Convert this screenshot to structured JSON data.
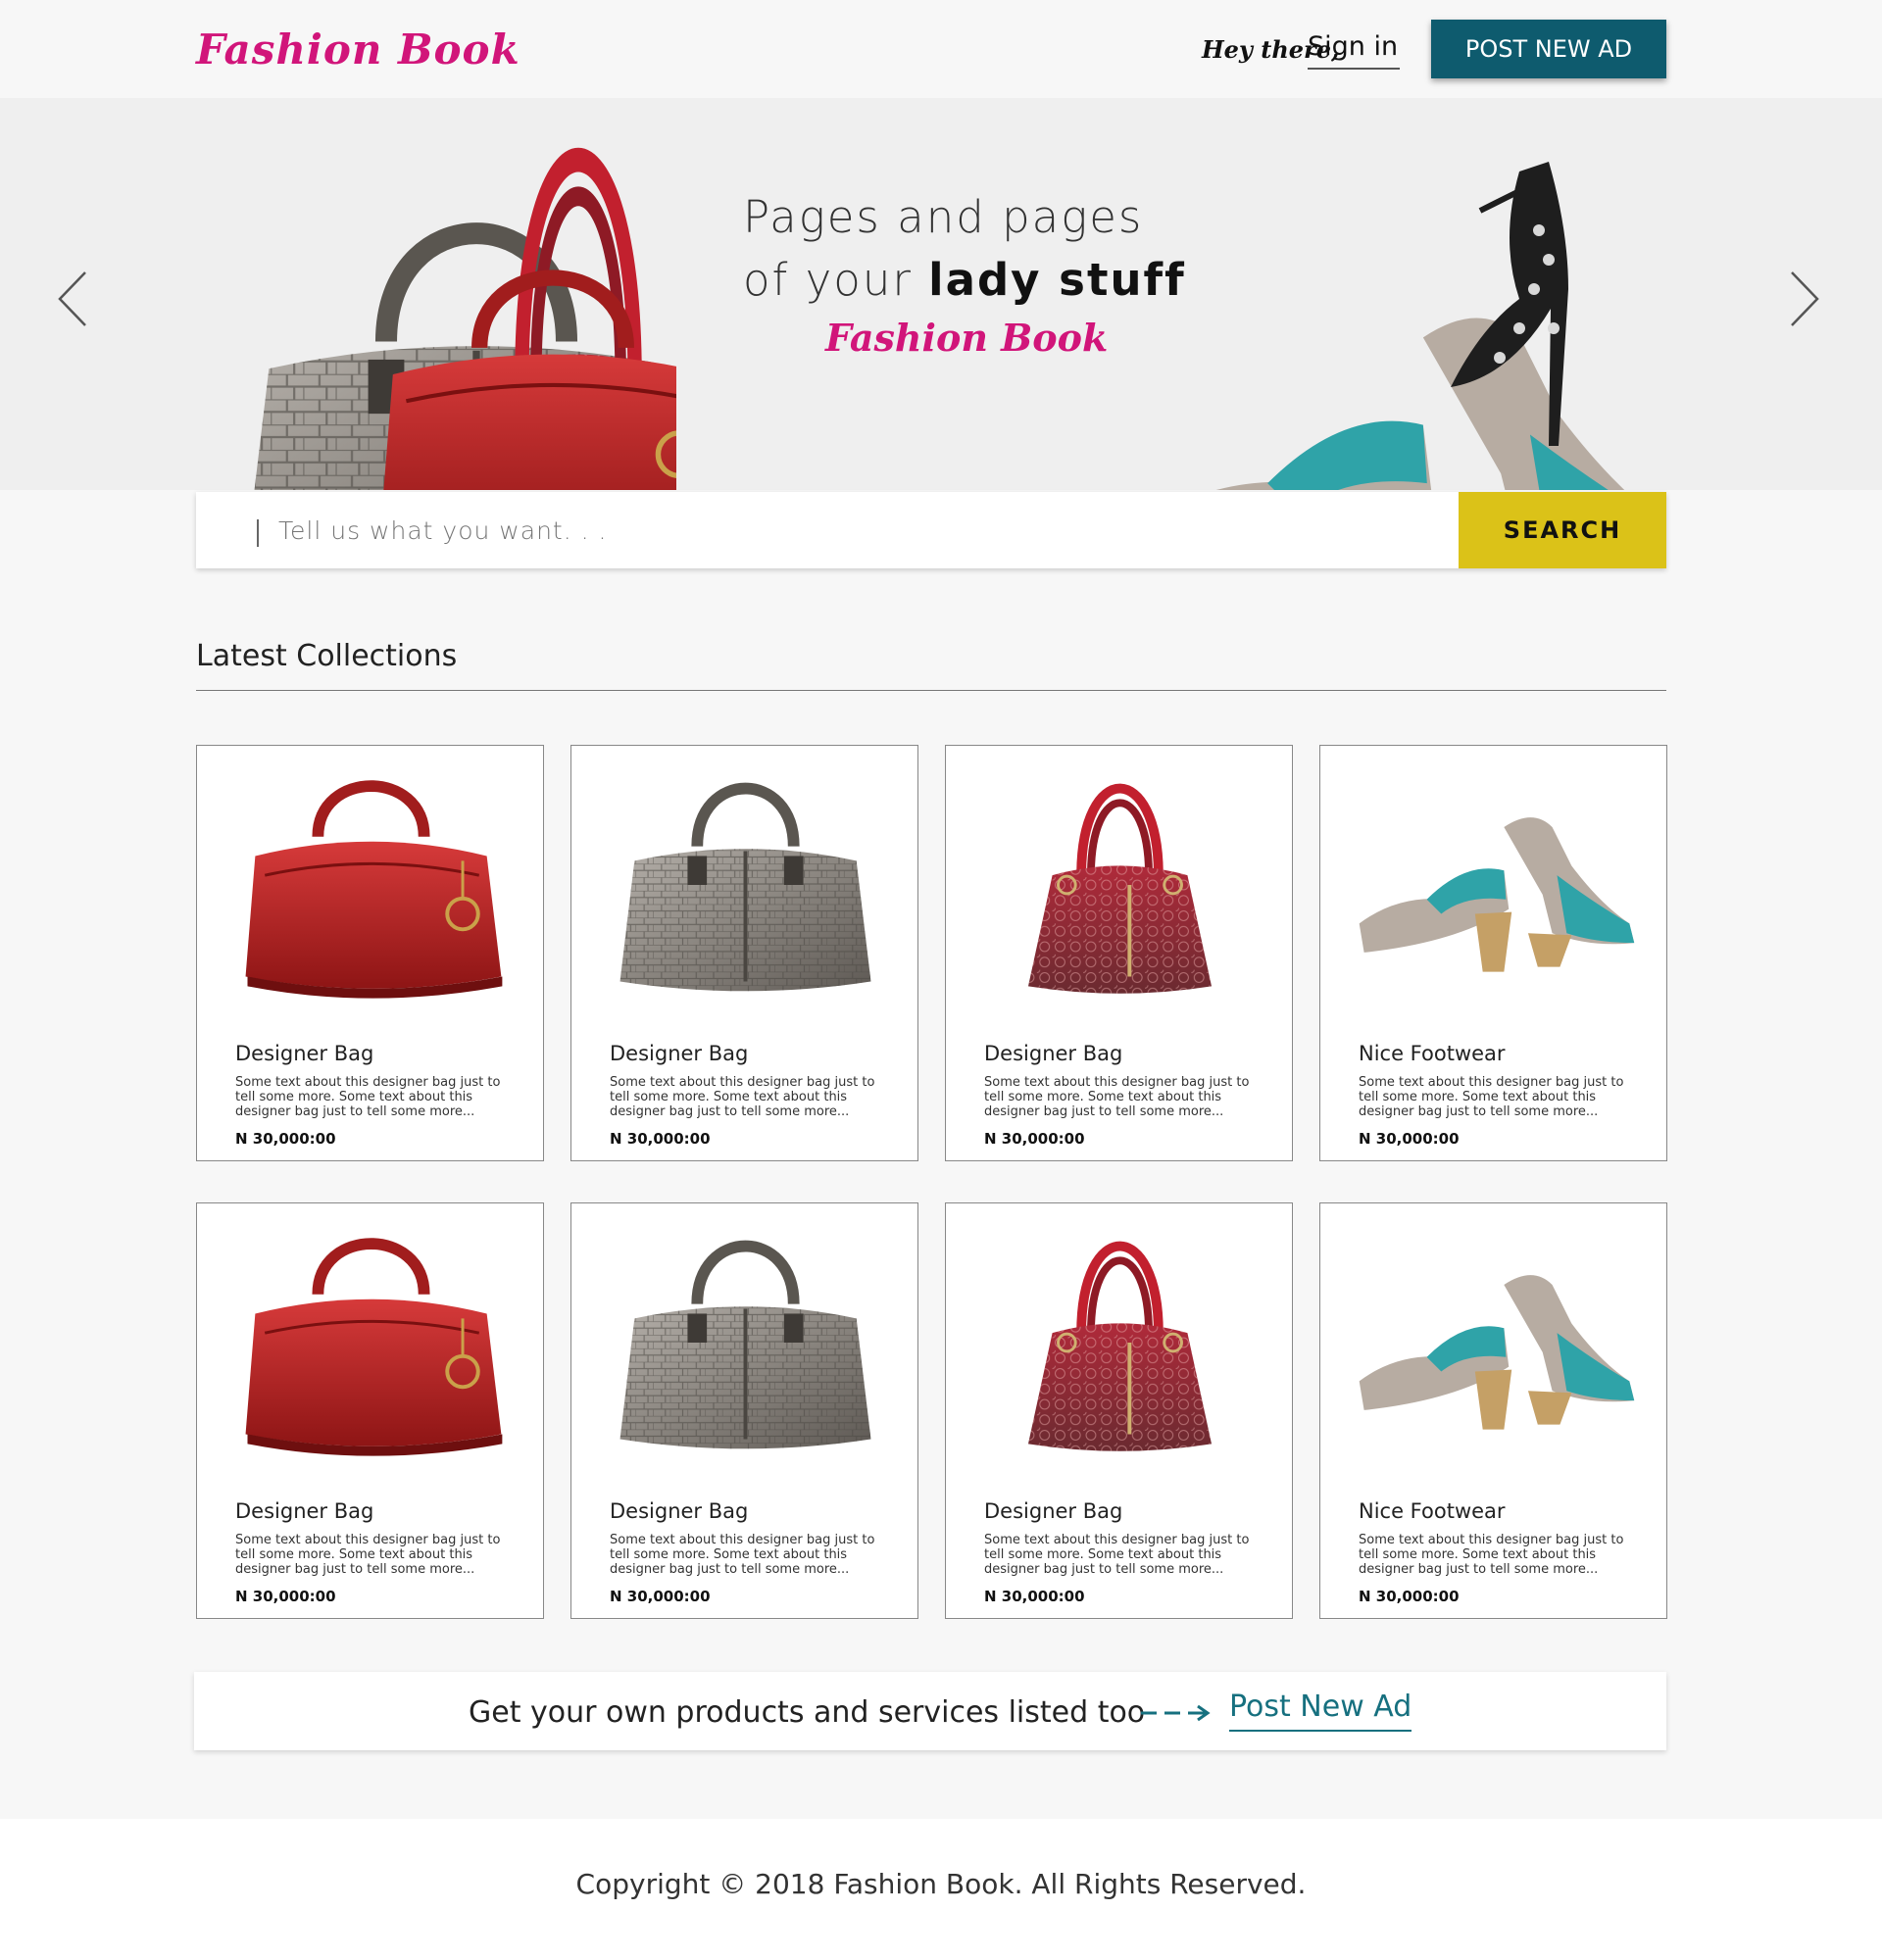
{
  "header": {
    "logo": "Fashion Book",
    "greeting": "Hey there,",
    "signin_label": "Sign in",
    "post_button_label": "POST NEW AD"
  },
  "hero": {
    "line1": "Pages and pages",
    "line2_prefix": "of your ",
    "line2_bold": "lady stuff",
    "brand": "Fashion Book",
    "prev_icon": "chevron-left-icon",
    "next_icon": "chevron-right-icon"
  },
  "search": {
    "placeholder": "Tell us what you want. . .",
    "button_label": "SEARCH"
  },
  "section": {
    "title": "Latest Collections"
  },
  "products": [
    {
      "image": "red-bag",
      "title": "Designer Bag",
      "description": "Some text about this designer bag just to tell some more. Some text about this designer bag just to tell some more...",
      "price": "N 30,000:00"
    },
    {
      "image": "grey-bag",
      "title": "Designer Bag",
      "description": "Some text about this designer bag just to tell some more. Some text about this designer bag just to tell some more...",
      "price": "N 30,000:00"
    },
    {
      "image": "maroon-bag",
      "title": "Designer Bag",
      "description": "Some text about this designer bag just to tell some more. Some text about this designer bag just to tell some more...",
      "price": "N 30,000:00"
    },
    {
      "image": "shoes",
      "title": "Nice Footwear",
      "description": "Some text about this designer bag just to tell some more. Some text about this designer bag just to tell some more...",
      "price": "N 30,000:00"
    },
    {
      "image": "red-bag",
      "title": "Designer Bag",
      "description": "Some text about this designer bag just to tell some more. Some text about this designer bag just to tell some more...",
      "price": "N 30,000:00"
    },
    {
      "image": "grey-bag",
      "title": "Designer Bag",
      "description": "Some text about this designer bag just to tell some more. Some text about this designer bag just to tell some more...",
      "price": "N 30,000:00"
    },
    {
      "image": "maroon-bag",
      "title": "Designer Bag",
      "description": "Some text about this designer bag just to tell some more. Some text about this designer bag just to tell some more...",
      "price": "N 30,000:00"
    },
    {
      "image": "shoes",
      "title": "Nice Footwear",
      "description": "Some text about this designer bag just to tell some more. Some text about this designer bag just to tell some more...",
      "price": "N 30,000:00"
    }
  ],
  "cta": {
    "text": "Get your own products and services listed too",
    "link_label": "Post New Ad",
    "arrow_icon": "dashed-arrow-right-icon"
  },
  "footer": {
    "copyright": "Copyright © 2018 Fashion Book. All Rights Reserved."
  },
  "colors": {
    "brand_pink": "#d1157a",
    "button_teal": "#0e5b6e",
    "search_yellow": "#dbc218",
    "link_teal": "#16707f"
  }
}
